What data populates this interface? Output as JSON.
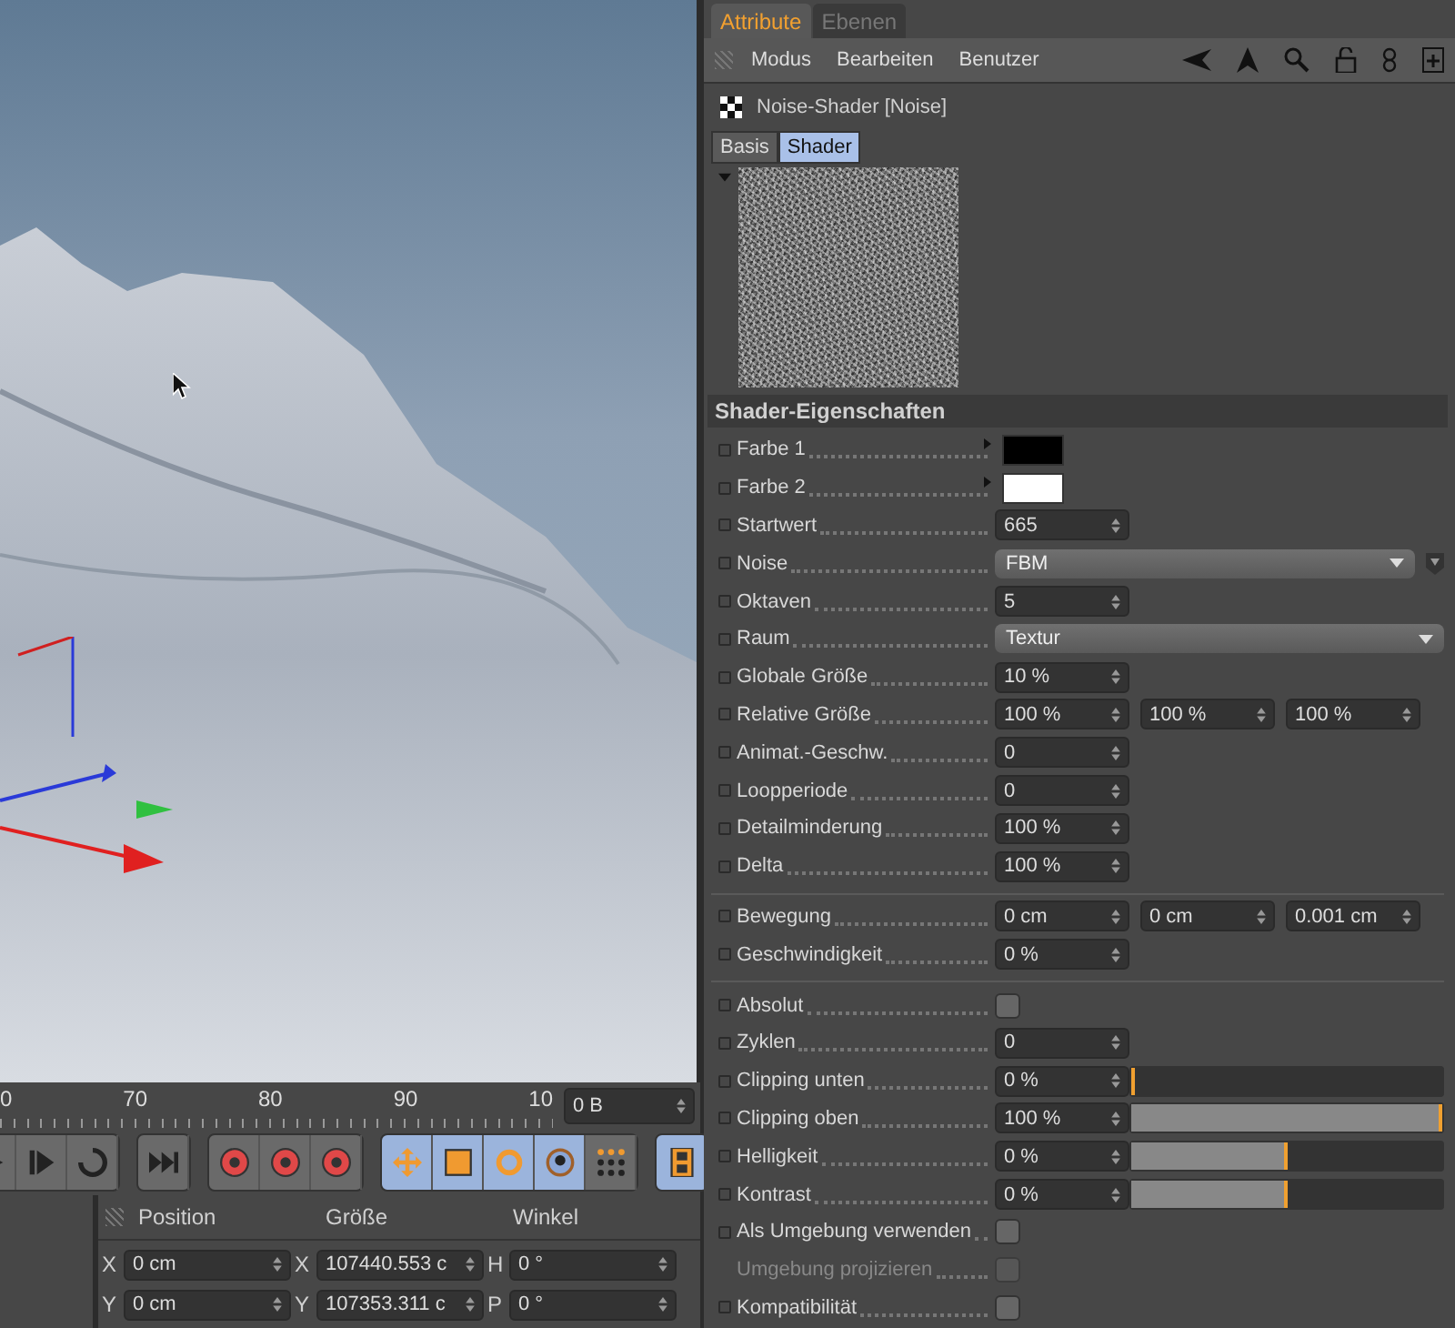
{
  "timeline": {
    "ticks": [
      "0",
      "70",
      "80",
      "90",
      "10"
    ],
    "frame": "0 B"
  },
  "coordinates": {
    "headers": [
      "Position",
      "Größe",
      "Winkel"
    ],
    "rows": [
      {
        "pos_axis": "X",
        "position": "0 cm",
        "size_axis": "X",
        "size": "107440.553 c",
        "angle_axis": "H",
        "angle": "0 °"
      },
      {
        "pos_axis": "Y",
        "position": "0 cm",
        "size_axis": "Y",
        "size": "107353.311 c",
        "angle_axis": "P",
        "angle": "0 °"
      }
    ]
  },
  "attributes": {
    "tabs": [
      {
        "label": "Attribute",
        "selected": true
      },
      {
        "label": "Ebenen",
        "selected": false
      }
    ],
    "menu": [
      "Modus",
      "Bearbeiten",
      "Benutzer"
    ],
    "object": "Noise-Shader [Noise]",
    "subtabs": [
      {
        "label": "Basis",
        "selected": false
      },
      {
        "label": "Shader",
        "selected": true
      }
    ],
    "section": "Shader-Eigenschaften",
    "groups": [
      {
        "params": [
          {
            "kind": "color",
            "label": "Farbe 1",
            "color": "#000000"
          },
          {
            "kind": "color",
            "label": "Farbe 2",
            "color": "#ffffff"
          },
          {
            "kind": "number",
            "label": "Startwert",
            "value": "665"
          },
          {
            "kind": "dropdown",
            "label": "Noise",
            "value": "FBM",
            "extra_button": true
          },
          {
            "kind": "number",
            "label": "Oktaven",
            "value": "5"
          },
          {
            "kind": "dropdown",
            "label": "Raum",
            "value": "Textur"
          },
          {
            "kind": "number",
            "label": "Globale Größe",
            "value": "10 %"
          },
          {
            "kind": "vector",
            "label": "Relative Größe",
            "values": [
              "100 %",
              "100 %",
              "100 %"
            ]
          },
          {
            "kind": "number",
            "label": "Animat.-Geschw.",
            "value": "0"
          },
          {
            "kind": "number",
            "label": "Loopperiode",
            "value": "0"
          },
          {
            "kind": "number",
            "label": "Detailminderung",
            "value": "100 %"
          },
          {
            "kind": "number",
            "label": "Delta",
            "value": "100 %"
          }
        ]
      },
      {
        "params": [
          {
            "kind": "vector",
            "label": "Bewegung",
            "values": [
              "0 cm",
              "0 cm",
              "0.001 cm"
            ]
          },
          {
            "kind": "number",
            "label": "Geschwindigkeit",
            "value": "0 %"
          }
        ]
      },
      {
        "params": [
          {
            "kind": "checkbox",
            "label": "Absolut",
            "checked": false,
            "disabled": false
          },
          {
            "kind": "number",
            "label": "Zyklen",
            "value": "0"
          },
          {
            "kind": "slider",
            "label": "Clipping unten",
            "value": "0 %",
            "level": 0
          },
          {
            "kind": "slider",
            "label": "Clipping oben",
            "value": "100 %",
            "level": 1
          },
          {
            "kind": "slider",
            "label": "Helligkeit",
            "value": "0 %",
            "level": 0.5
          },
          {
            "kind": "slider",
            "label": "Kontrast",
            "value": "0 %",
            "level": 0.5
          },
          {
            "kind": "checkbox",
            "label": "Als Umgebung verwenden",
            "checked": false,
            "disabled": false
          },
          {
            "kind": "checkbox",
            "label": "Umgebung projizieren",
            "checked": false,
            "disabled": true
          },
          {
            "kind": "checkbox",
            "label": "Kompatibilität",
            "checked": false,
            "disabled": false
          }
        ]
      }
    ]
  }
}
